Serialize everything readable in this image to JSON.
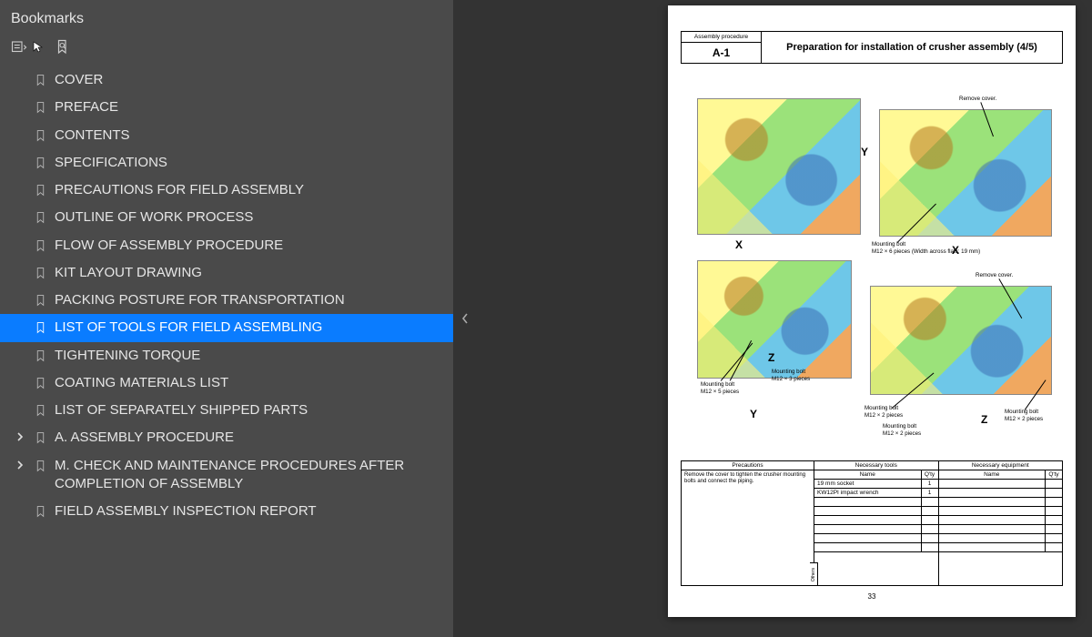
{
  "sidebar": {
    "title": "Bookmarks",
    "items": [
      {
        "label": "COVER"
      },
      {
        "label": "PREFACE"
      },
      {
        "label": "CONTENTS"
      },
      {
        "label": "SPECIFICATIONS"
      },
      {
        "label": "PRECAUTIONS FOR FIELD ASSEMBLY"
      },
      {
        "label": "OUTLINE OF WORK PROCESS"
      },
      {
        "label": "FLOW OF ASSEMBLY PROCEDURE"
      },
      {
        "label": "KIT LAYOUT DRAWING"
      },
      {
        "label": "PACKING POSTURE FOR TRANSPORTATION"
      },
      {
        "label": "LIST OF TOOLS FOR FIELD ASSEMBLING",
        "selected": true
      },
      {
        "label": "TIGHTENING TORQUE"
      },
      {
        "label": "COATING MATERIALS LIST"
      },
      {
        "label": "LIST OF SEPARATELY SHIPPED PARTS"
      },
      {
        "label": "A. ASSEMBLY PROCEDURE",
        "expandable": true
      },
      {
        "label": "M. CHECK AND MAINTENANCE PROCEDURES AFTER COMPLETION OF ASSEMBLY",
        "expandable": true
      },
      {
        "label": "FIELD ASSEMBLY INSPECTION REPORT"
      }
    ]
  },
  "doc": {
    "procLabel": "Assembly procedure",
    "procCode": "A-1",
    "title": "Preparation for installation of crusher assembly (4/5)",
    "pageNum": "33",
    "annotations": {
      "removeCover1": "Remove cover.",
      "removeCover2": "Remove cover.",
      "mbX": "Mounting bolt",
      "mbXdet": "M12 × 6 pieces (Width across flats: 19 mm)",
      "mbY": "Mounting bolt",
      "mbYdet": "M12 × 5 pieces",
      "mbZ1": "Mounting bolt",
      "mbZ1det": "M12 × 3 pieces",
      "mbZ2": "Mounting bolt",
      "mbZ2det": "M12 × 2 pieces",
      "mbZ3": "Mounting bolt",
      "mbZ3det": "M12 × 2 pieces",
      "mbZ4": "Mounting bolt",
      "mbZ4det": "M12 × 2 pieces",
      "axisX1": "X",
      "axisY1": "Y",
      "axisX2": "X",
      "axisY2": "Y",
      "axisZ1": "Z",
      "axisZ2": "Z"
    },
    "tables": {
      "precHeader": "Precautions",
      "precText": "Remove the cover to tighten the crusher mounting bolts and connect the piping.",
      "toolsHeader": "Necessary tools",
      "nameHdr": "Name",
      "qtyHdr": "Q'ty",
      "toolRows": [
        {
          "name": "19 mm socket",
          "qty": "1"
        },
        {
          "name": "KW12PI impact wrench",
          "qty": "1"
        }
      ],
      "equipHeader": "Necessary equipment",
      "othersLabel": "Others"
    }
  }
}
